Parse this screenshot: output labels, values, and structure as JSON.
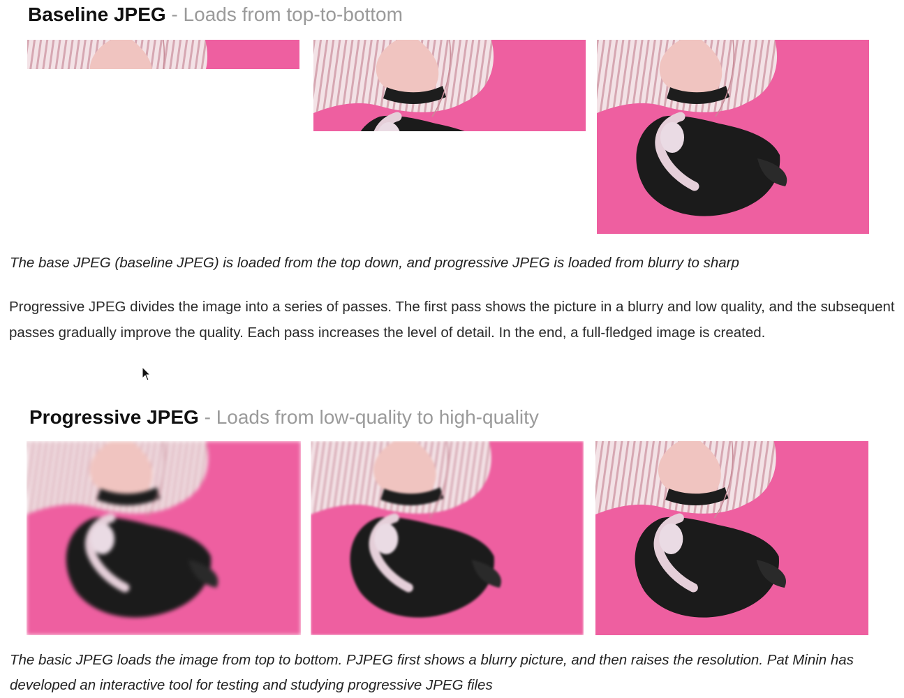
{
  "baseline": {
    "title": "Baseline JPEG",
    "separator": " - ",
    "subtitle": "Loads from top-to-bottom",
    "frames": [
      {
        "label": "baseline-stage-1",
        "loaded_fraction": 0.15
      },
      {
        "label": "baseline-stage-2",
        "loaded_fraction": 0.47
      },
      {
        "label": "baseline-stage-3",
        "loaded_fraction": 1.0
      }
    ]
  },
  "caption1": "The base JPEG (baseline JPEG) is loaded from the top down, and progressive JPEG is loaded from blurry to sharp",
  "paragraph": "Progressive JPEG divides the image into a series of passes. The first pass shows the picture in a blurry and low quality, and the subsequent passes gradually improve the quality. Each pass increases the level of detail. In the end, a full-fledged image is created.",
  "progressive": {
    "title": "Progressive JPEG",
    "separator": " - ",
    "subtitle": "Loads from low-quality to high-quality",
    "frames": [
      {
        "label": "progressive-pass-1"
      },
      {
        "label": "progressive-pass-2"
      },
      {
        "label": "progressive-pass-3"
      }
    ]
  },
  "caption2": "The basic JPEG loads the image from top to bottom. PJPEG first shows a blurry picture, and then raises the resolution. Pat Minin has developed an interactive tool for testing and studying progressive JPEG files",
  "colors": {
    "pink": "#ee5fa0",
    "hair": "#1c1c1c",
    "shirt": "#efd6dc"
  }
}
